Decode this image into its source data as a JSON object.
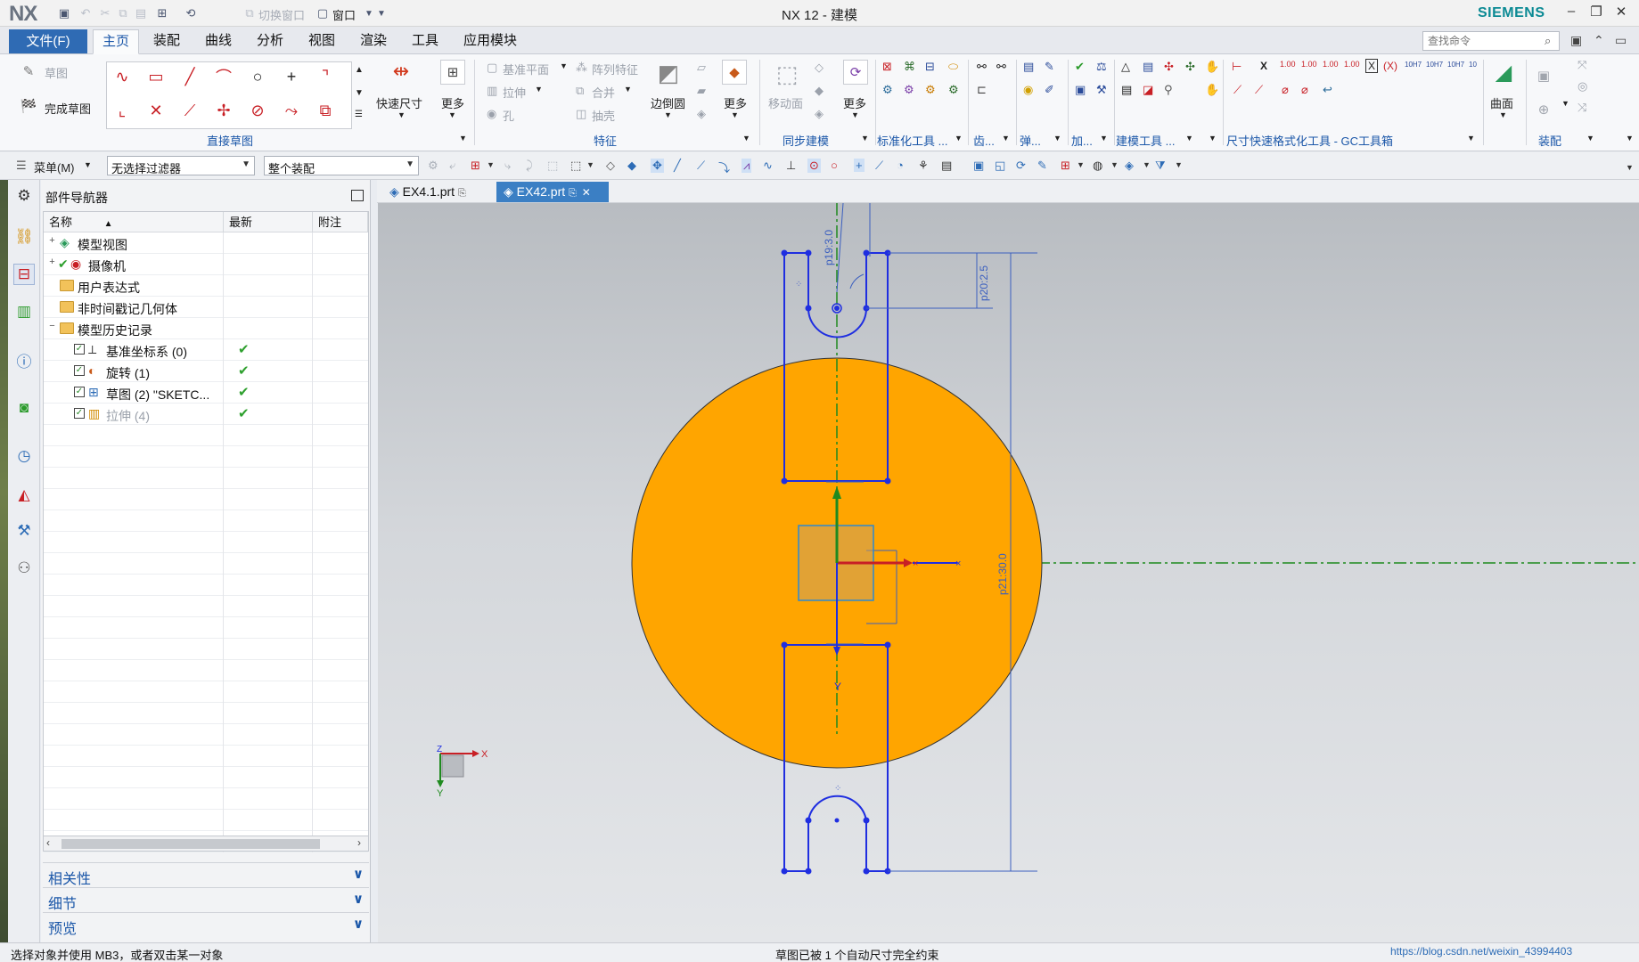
{
  "window": {
    "logo": "NX",
    "title": "NX 12 - 建模",
    "brand": "SIEMENS",
    "switch_window_label": "切换窗口",
    "window_label": "窗口"
  },
  "menu": {
    "file": "文件(F)",
    "tabs": [
      "主页",
      "装配",
      "曲线",
      "分析",
      "视图",
      "渲染",
      "工具",
      "应用模块"
    ],
    "active_tab": "主页",
    "search_placeholder": "查找命令"
  },
  "ribbon": {
    "sketch": "草图",
    "finish_sketch": "完成草图",
    "group_direct_sketch": "直接草图",
    "rapid_dimension": "快速尺寸",
    "more": "更多",
    "datum_plane": "基准平面",
    "pattern_feature": "阵列特征",
    "extrude": "拉伸",
    "unite": "合并",
    "hole": "孔",
    "shell": "抽壳",
    "edge_blend": "边倒圆",
    "group_feature": "特征",
    "move_face": "移动面",
    "group_sync": "同步建模",
    "group_std_tools": "标准化工具 ...",
    "group_gear": "齿...",
    "group_spring": "弹...",
    "group_add": "加...",
    "group_modeling_tools": "建模工具 ...",
    "group_dim_tools": "尺寸快速格式化工具 - GC工具箱",
    "surface": "曲面",
    "group_assembly": "装配"
  },
  "selection_bar": {
    "menu": "菜单(M)",
    "filter": "无选择过滤器",
    "scope": "整个装配"
  },
  "navigator": {
    "title": "部件导航器",
    "columns": [
      "名称",
      "最新",
      "附注"
    ],
    "rows": [
      {
        "label": "模型视图",
        "updated": ""
      },
      {
        "label": "摄像机",
        "updated": ""
      },
      {
        "label": "用户表达式",
        "updated": ""
      },
      {
        "label": "非时间戳记几何体",
        "updated": ""
      },
      {
        "label": "模型历史记录",
        "updated": ""
      },
      {
        "label": "基准坐标系 (0)",
        "updated": "✔"
      },
      {
        "label": "旋转 (1)",
        "updated": "✔"
      },
      {
        "label": "草图 (2) \"SKETC...",
        "updated": "✔"
      },
      {
        "label": "拉伸 (4)",
        "updated": "✔"
      }
    ],
    "sections": [
      "相关性",
      "细节",
      "预览"
    ]
  },
  "doc_tabs": [
    {
      "name": "EX4.1.prt",
      "active": false
    },
    {
      "name": "EX42.prt",
      "active": true
    }
  ],
  "viewport": {
    "dims": [
      "p19:3.0",
      "p20:2.5",
      "p21:30.0"
    ],
    "axis_x": "X",
    "axis_y": "Y",
    "colors": {
      "disc": "#ffa500",
      "sketch": "#1f2ee0",
      "axis_green": "#1f8a1f"
    }
  },
  "status": {
    "left": "选择对象并使用 MB3，或者双击某一对象",
    "center": "草图已被 1 个自动尺寸完全约束",
    "right": "https://blog.csdn.net/weixin_43994403"
  }
}
